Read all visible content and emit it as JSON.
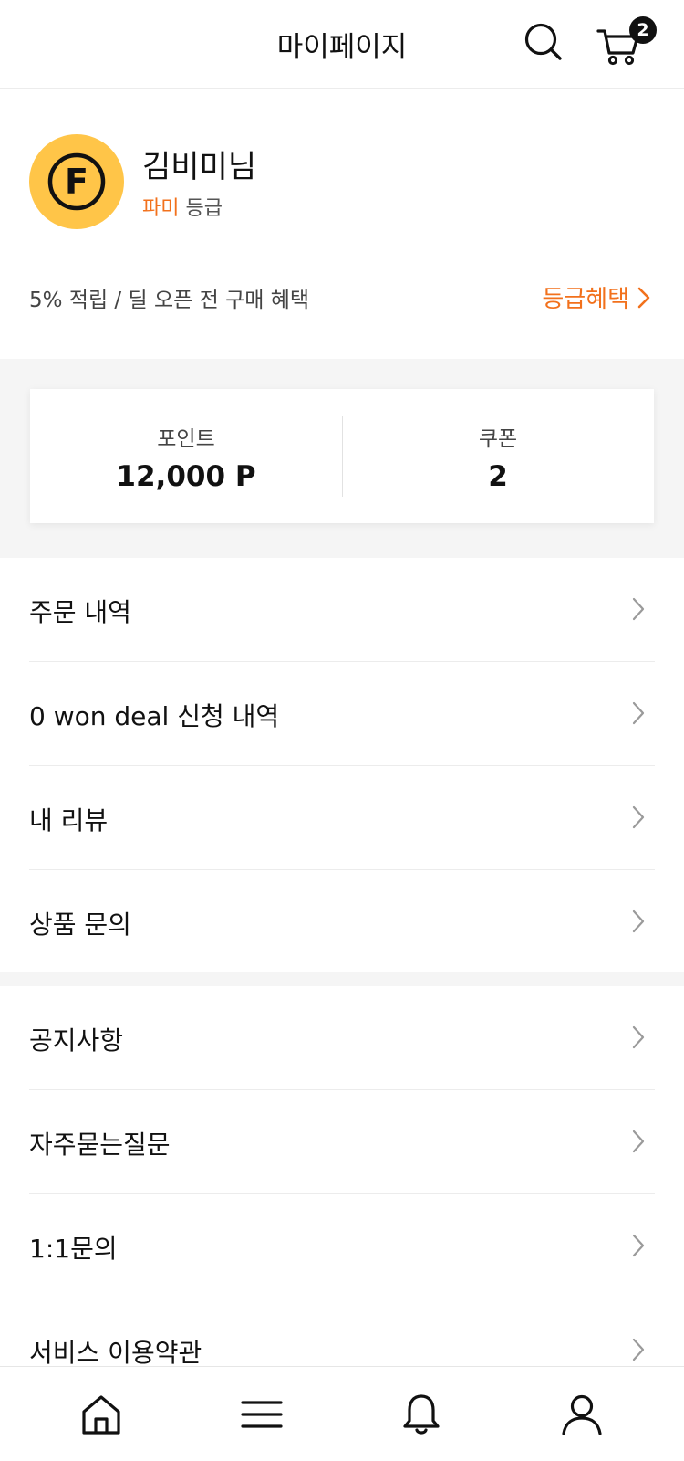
{
  "header": {
    "title": "마이페이지",
    "search_icon": "search-icon",
    "cart_icon": "cart-icon",
    "cart_count": "2"
  },
  "profile": {
    "avatar_letter": "F",
    "user_name": "김비미님",
    "grade_name": "파미",
    "grade_suffix": "등급",
    "benefit_summary": "5% 적립 / 딜 오픈 전 구매 혜택",
    "benefit_link_label": "등급혜택"
  },
  "stats": {
    "points_label": "포인트",
    "points_value": "12,000 P",
    "coupons_label": "쿠폰",
    "coupons_value": "2"
  },
  "menu_group_1": [
    {
      "label": "주문 내역"
    },
    {
      "label": "0 won deal 신청 내역"
    },
    {
      "label": "내 리뷰"
    },
    {
      "label": "상품 문의"
    }
  ],
  "menu_group_2": [
    {
      "label": "공지사항"
    },
    {
      "label": "자주묻는질문"
    },
    {
      "label": "1:1문의"
    },
    {
      "label": "서비스 이용약관"
    }
  ],
  "bottom_nav": {
    "items": [
      "home-icon",
      "menu-icon",
      "bell-icon",
      "user-icon"
    ]
  },
  "colors": {
    "accent": "#F2711C",
    "avatar_bg": "#FFC548"
  }
}
